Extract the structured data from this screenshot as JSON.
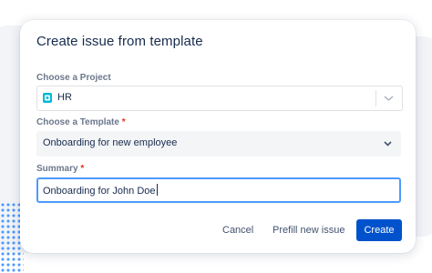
{
  "dialog": {
    "title": "Create issue from template"
  },
  "project": {
    "label": "Choose a Project",
    "value": "HR",
    "icon": "project-avatar-icon",
    "icon_color": "#00b8d9"
  },
  "template": {
    "label": "Choose a Template",
    "required_marker": "*",
    "value": "Onboarding for new employee"
  },
  "summary": {
    "label": "Summary",
    "required_marker": "*",
    "value": "Onboarding for John Doe"
  },
  "buttons": {
    "cancel": "Cancel",
    "prefill": "Prefill new issue",
    "create": "Create"
  },
  "colors": {
    "primary": "#0052cc",
    "focus_border": "#4c9aff",
    "required": "#de350b",
    "title_text": "#172b4d"
  }
}
